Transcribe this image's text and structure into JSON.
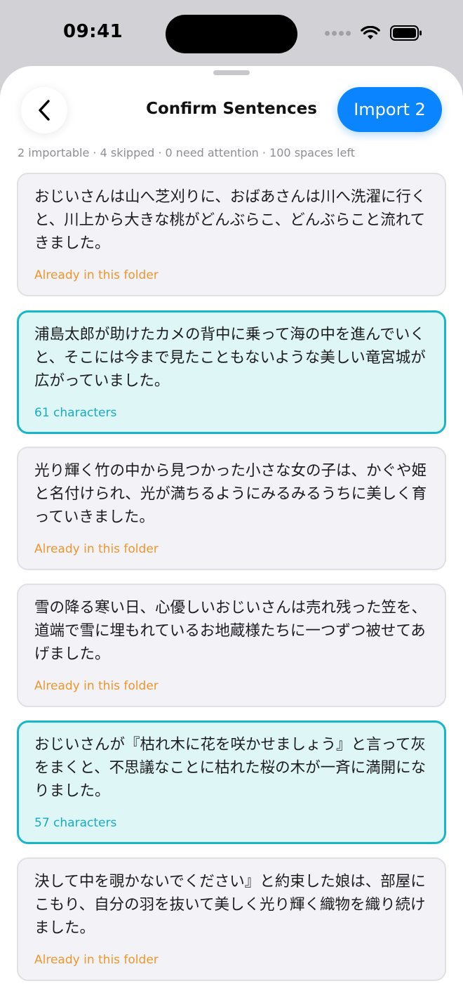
{
  "status": {
    "time": "09:41"
  },
  "header": {
    "title": "Confirm Sentences",
    "import_label": "Import 2"
  },
  "summary": "2 importable · 4 skipped · 0 need attention · 100 spaces left",
  "items": [
    {
      "text": "おじいさんは山へ芝刈りに、おばあさんは川へ洗濯に行くと、川上から大きな桃がどんぶらこ、どんぶらこと流れてきました。",
      "meta": "Already in this folder",
      "state": "skipped"
    },
    {
      "text": "浦島太郎が助けたカメの背中に乗って海の中を進んでいくと、そこには今まで見たこともないような美しい竜宮城が広がっていました。",
      "meta": "61 characters",
      "state": "importable"
    },
    {
      "text": "光り輝く竹の中から見つかった小さな女の子は、かぐや姫と名付けられ、光が満ちるようにみるみるうちに美しく育っていきました。",
      "meta": "Already in this folder",
      "state": "skipped"
    },
    {
      "text": "雪の降る寒い日、心優しいおじいさんは売れ残った笠を、道端で雪に埋もれているお地蔵様たちに一つずつ被せてあげました。",
      "meta": "Already in this folder",
      "state": "skipped"
    },
    {
      "text": "おじいさんが『枯れ木に花を咲かせましょう』と言って灰をまくと、不思議なことに枯れた桜の木が一斉に満開になりました。",
      "meta": "57 characters",
      "state": "importable"
    },
    {
      "text": "決して中を覗かないでください』と約束した娘は、部屋にこもり、自分の羽を抜いて美しく光り輝く織物を織り続けました。",
      "meta": "Already in this folder",
      "state": "skipped"
    }
  ],
  "colors": {
    "accent": "#0a84ff",
    "importable": "#18b6c9",
    "skipped": "#f0962e"
  }
}
